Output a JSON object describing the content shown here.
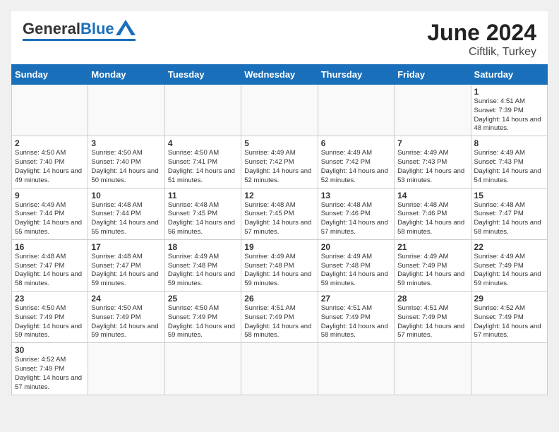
{
  "header": {
    "logo_general": "General",
    "logo_blue": "Blue",
    "title": "June 2024",
    "subtitle": "Ciftlik, Turkey"
  },
  "weekdays": [
    "Sunday",
    "Monday",
    "Tuesday",
    "Wednesday",
    "Thursday",
    "Friday",
    "Saturday"
  ],
  "weeks": [
    [
      {
        "day": "",
        "info": ""
      },
      {
        "day": "",
        "info": ""
      },
      {
        "day": "",
        "info": ""
      },
      {
        "day": "",
        "info": ""
      },
      {
        "day": "",
        "info": ""
      },
      {
        "day": "",
        "info": ""
      },
      {
        "day": "1",
        "info": "Sunrise: 4:51 AM\nSunset: 7:39 PM\nDaylight: 14 hours and 48 minutes."
      }
    ],
    [
      {
        "day": "2",
        "info": "Sunrise: 4:50 AM\nSunset: 7:40 PM\nDaylight: 14 hours and 49 minutes."
      },
      {
        "day": "3",
        "info": "Sunrise: 4:50 AM\nSunset: 7:40 PM\nDaylight: 14 hours and 50 minutes."
      },
      {
        "day": "4",
        "info": "Sunrise: 4:50 AM\nSunset: 7:41 PM\nDaylight: 14 hours and 51 minutes."
      },
      {
        "day": "5",
        "info": "Sunrise: 4:49 AM\nSunset: 7:42 PM\nDaylight: 14 hours and 52 minutes."
      },
      {
        "day": "6",
        "info": "Sunrise: 4:49 AM\nSunset: 7:42 PM\nDaylight: 14 hours and 52 minutes."
      },
      {
        "day": "7",
        "info": "Sunrise: 4:49 AM\nSunset: 7:43 PM\nDaylight: 14 hours and 53 minutes."
      },
      {
        "day": "8",
        "info": "Sunrise: 4:49 AM\nSunset: 7:43 PM\nDaylight: 14 hours and 54 minutes."
      }
    ],
    [
      {
        "day": "9",
        "info": "Sunrise: 4:49 AM\nSunset: 7:44 PM\nDaylight: 14 hours and 55 minutes."
      },
      {
        "day": "10",
        "info": "Sunrise: 4:48 AM\nSunset: 7:44 PM\nDaylight: 14 hours and 55 minutes."
      },
      {
        "day": "11",
        "info": "Sunrise: 4:48 AM\nSunset: 7:45 PM\nDaylight: 14 hours and 56 minutes."
      },
      {
        "day": "12",
        "info": "Sunrise: 4:48 AM\nSunset: 7:45 PM\nDaylight: 14 hours and 57 minutes."
      },
      {
        "day": "13",
        "info": "Sunrise: 4:48 AM\nSunset: 7:46 PM\nDaylight: 14 hours and 57 minutes."
      },
      {
        "day": "14",
        "info": "Sunrise: 4:48 AM\nSunset: 7:46 PM\nDaylight: 14 hours and 58 minutes."
      },
      {
        "day": "15",
        "info": "Sunrise: 4:48 AM\nSunset: 7:47 PM\nDaylight: 14 hours and 58 minutes."
      }
    ],
    [
      {
        "day": "16",
        "info": "Sunrise: 4:48 AM\nSunset: 7:47 PM\nDaylight: 14 hours and 58 minutes."
      },
      {
        "day": "17",
        "info": "Sunrise: 4:48 AM\nSunset: 7:47 PM\nDaylight: 14 hours and 59 minutes."
      },
      {
        "day": "18",
        "info": "Sunrise: 4:49 AM\nSunset: 7:48 PM\nDaylight: 14 hours and 59 minutes."
      },
      {
        "day": "19",
        "info": "Sunrise: 4:49 AM\nSunset: 7:48 PM\nDaylight: 14 hours and 59 minutes."
      },
      {
        "day": "20",
        "info": "Sunrise: 4:49 AM\nSunset: 7:48 PM\nDaylight: 14 hours and 59 minutes."
      },
      {
        "day": "21",
        "info": "Sunrise: 4:49 AM\nSunset: 7:49 PM\nDaylight: 14 hours and 59 minutes."
      },
      {
        "day": "22",
        "info": "Sunrise: 4:49 AM\nSunset: 7:49 PM\nDaylight: 14 hours and 59 minutes."
      }
    ],
    [
      {
        "day": "23",
        "info": "Sunrise: 4:50 AM\nSunset: 7:49 PM\nDaylight: 14 hours and 59 minutes."
      },
      {
        "day": "24",
        "info": "Sunrise: 4:50 AM\nSunset: 7:49 PM\nDaylight: 14 hours and 59 minutes."
      },
      {
        "day": "25",
        "info": "Sunrise: 4:50 AM\nSunset: 7:49 PM\nDaylight: 14 hours and 59 minutes."
      },
      {
        "day": "26",
        "info": "Sunrise: 4:51 AM\nSunset: 7:49 PM\nDaylight: 14 hours and 58 minutes."
      },
      {
        "day": "27",
        "info": "Sunrise: 4:51 AM\nSunset: 7:49 PM\nDaylight: 14 hours and 58 minutes."
      },
      {
        "day": "28",
        "info": "Sunrise: 4:51 AM\nSunset: 7:49 PM\nDaylight: 14 hours and 57 minutes."
      },
      {
        "day": "29",
        "info": "Sunrise: 4:52 AM\nSunset: 7:49 PM\nDaylight: 14 hours and 57 minutes."
      }
    ],
    [
      {
        "day": "30",
        "info": "Sunrise: 4:52 AM\nSunset: 7:49 PM\nDaylight: 14 hours and 57 minutes."
      },
      {
        "day": "",
        "info": ""
      },
      {
        "day": "",
        "info": ""
      },
      {
        "day": "",
        "info": ""
      },
      {
        "day": "",
        "info": ""
      },
      {
        "day": "",
        "info": ""
      },
      {
        "day": "",
        "info": ""
      }
    ]
  ]
}
